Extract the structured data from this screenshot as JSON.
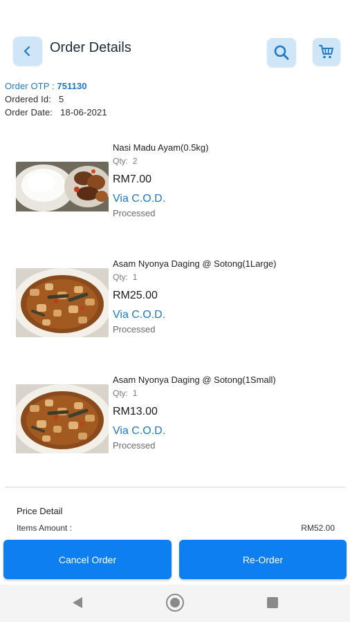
{
  "header": {
    "title": "Order Details",
    "back_icon": "chevron-left-icon",
    "search_icon": "search-icon",
    "cart_icon": "cart-icon"
  },
  "order": {
    "otp_label": "Order OTP :",
    "otp_value": "751130",
    "id_label": "Ordered Id:",
    "id_value": "5",
    "date_label": "Order Date:",
    "date_value": "18-06-2021"
  },
  "items": [
    {
      "name": "Nasi Madu Ayam(0.5kg)",
      "qty_label": "Qty:",
      "qty": "2",
      "price": "RM7.00",
      "payment": "Via C.O.D.",
      "status": "Processed"
    },
    {
      "name": "Asam Nyonya Daging @ Sotong(1Large)",
      "qty_label": "Qty:",
      "qty": "1",
      "price": "RM25.00",
      "payment": "Via C.O.D.",
      "status": "Processed"
    },
    {
      "name": "Asam Nyonya Daging @ Sotong(1Small)",
      "qty_label": "Qty:",
      "qty": "1",
      "price": "RM13.00",
      "payment": "Via C.O.D.",
      "status": "Processed"
    }
  ],
  "price_detail": {
    "title": "Price Detail",
    "items_amount_label": "Items Amount :",
    "items_amount_value": "RM52.00"
  },
  "actions": {
    "cancel_label": "Cancel Order",
    "reorder_label": "Re-Order"
  },
  "colors": {
    "accent": "#1e78c8",
    "button": "#0d7ff0",
    "icon_bg": "#cfe6f9"
  }
}
